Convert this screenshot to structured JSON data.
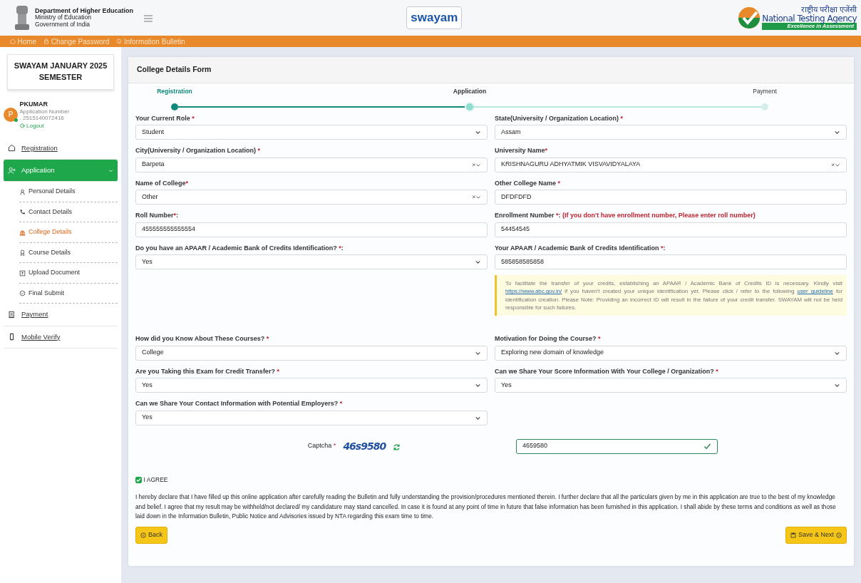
{
  "header": {
    "dept_title": "Department of Higher Education",
    "dept_lines": [
      "Ministry of Education",
      "Government of India"
    ],
    "center_logo": "swayam",
    "agency_hindi": "राष्ट्रीय परीक्षा एजेंसी",
    "agency_name": "National Testing Agency",
    "agency_tagline": "Excellence in Assessment"
  },
  "topnav": [
    {
      "label": "Home"
    },
    {
      "label": "Change Password"
    },
    {
      "label": "Information Bulletin"
    }
  ],
  "sidebar": {
    "exam_title": "SWAYAM JANUARY 2025 SEMESTER",
    "user": {
      "initial": "P",
      "name": "PKUMAR",
      "number_label": "Application Number",
      "number": ". 2515140072416",
      "logout": "Logout"
    },
    "items": [
      {
        "label": "Registration",
        "selected": false
      },
      {
        "label": "Application",
        "selected": true,
        "expanded": true,
        "children": [
          {
            "label": "Personal Details",
            "selected": false
          },
          {
            "label": "Contact Details",
            "selected": false
          },
          {
            "label": "College Details",
            "selected": true
          },
          {
            "label": "Course Details",
            "selected": false
          },
          {
            "label": "Upload Document",
            "selected": false
          },
          {
            "label": "Final Submit",
            "selected": false
          }
        ]
      },
      {
        "label": "Payment",
        "selected": false
      },
      {
        "label": "Mobile Verify",
        "selected": false
      }
    ]
  },
  "form": {
    "title": "College Details Form",
    "steps": [
      {
        "label": "Registration",
        "completed": true,
        "selected": false
      },
      {
        "label": "Application",
        "completed": false,
        "selected": true
      },
      {
        "label": "Payment",
        "completed": false,
        "selected": false
      }
    ],
    "rows": [
      [
        {
          "label": "Your Current Role",
          "req": " *",
          "kind": "select",
          "value": "Student"
        },
        {
          "label": "State(University / Organization Location)",
          "req": " *",
          "kind": "select",
          "value": "Assam"
        }
      ],
      [
        {
          "label": "City(University / Organization Location)",
          "req": " *",
          "kind": "clearable",
          "value": "Barpeta"
        },
        {
          "label": "University Name",
          "req": "*",
          "kind": "clearable",
          "value": "KRISHNAGURU ADHYATMIK VISVAVIDYALAYA"
        }
      ],
      [
        {
          "label": "Name of College",
          "req": "*",
          "kind": "clearable",
          "value": "Other"
        },
        {
          "label": "Other College Name",
          "req": " *",
          "kind": "text",
          "value": "DFDFDFD"
        }
      ],
      [
        {
          "label": "Roll Number",
          "req": "*",
          "after": ":",
          "kind": "text",
          "value": "455555555555554"
        },
        {
          "label": "Enrollment Number",
          "req": " *",
          "after": ":",
          "note": "(If you don't have enrollment number, Please enter roll number)",
          "kind": "text",
          "value": "54454545"
        }
      ],
      [
        {
          "label": "Do you have an APAAR / Academic Bank of Credits Identification?",
          "req": " *",
          "after": ":",
          "kind": "select",
          "value": "Yes"
        },
        {
          "label": "Your APAAR / Academic Bank of Credits Identification",
          "req": " *",
          "after": ":",
          "kind": "text",
          "value": "585858585858",
          "notice": [
            {
              "kind": "text",
              "text": "To facilitate the transfer of your credits, establishing an APAAR / Academic Bank of Credits ID is necessary. Kindly visit"
            },
            {
              "kind": "link",
              "text": "https://www.abc.gov.in/"
            },
            {
              "kind": "text",
              "text": "if you haven't created your unique identification yet. Please click / refer to the following"
            },
            {
              "kind": "link",
              "text": "user guideline"
            },
            {
              "kind": "text",
              "text": "for identification creation. Please Note: Providing an incorrect ID will result in the failure of your credit transfer. SWAYAM will not be held responsible for such failures."
            }
          ]
        }
      ],
      [
        {
          "label": "How did you Know About These Courses?",
          "req": " *",
          "kind": "select",
          "value": "College"
        },
        {
          "label": "Motivation for Doing the Course?",
          "req": " *",
          "kind": "select",
          "value": "Exploring new domain of knowledge"
        }
      ],
      [
        {
          "label": "Are you Taking this Exam for Credit Transfer?",
          "req": " *",
          "kind": "select",
          "value": "Yes"
        },
        {
          "label": "Can we Share Your Score Information With Your College / Organization?",
          "req": " *",
          "kind": "select",
          "value": "Yes"
        }
      ],
      [
        {
          "label": "Can we Share Your Contact Information with Potential Employers?",
          "req": " *",
          "kind": "select",
          "value": "Yes"
        }
      ]
    ],
    "captcha": {
      "label": "Captcha",
      "req": " *",
      "image_text": "46s9580",
      "value": "4659580",
      "valid": true
    },
    "agree": {
      "label": "I AGREE",
      "checked": true
    },
    "declaration": "I hereby declare that I have filled up this online application after carefully reading the Bulletin and fully understanding the provision/procedures mentioned therein. I further declare that all the particulars given by me in this application are true to the best of my knowledge and belief. I agree that my result may be withheld/not declared/ my candidature may stand cancelled. In case it is found at any point of time in future that false information has been furnished in this application. I shall abide by these terms and conditions as well as those laid down in the Information Bulletin, Public Notice and Advisories issued by NTA regarding this exam time to time.",
    "back": "Back",
    "next": "Save & Next"
  }
}
